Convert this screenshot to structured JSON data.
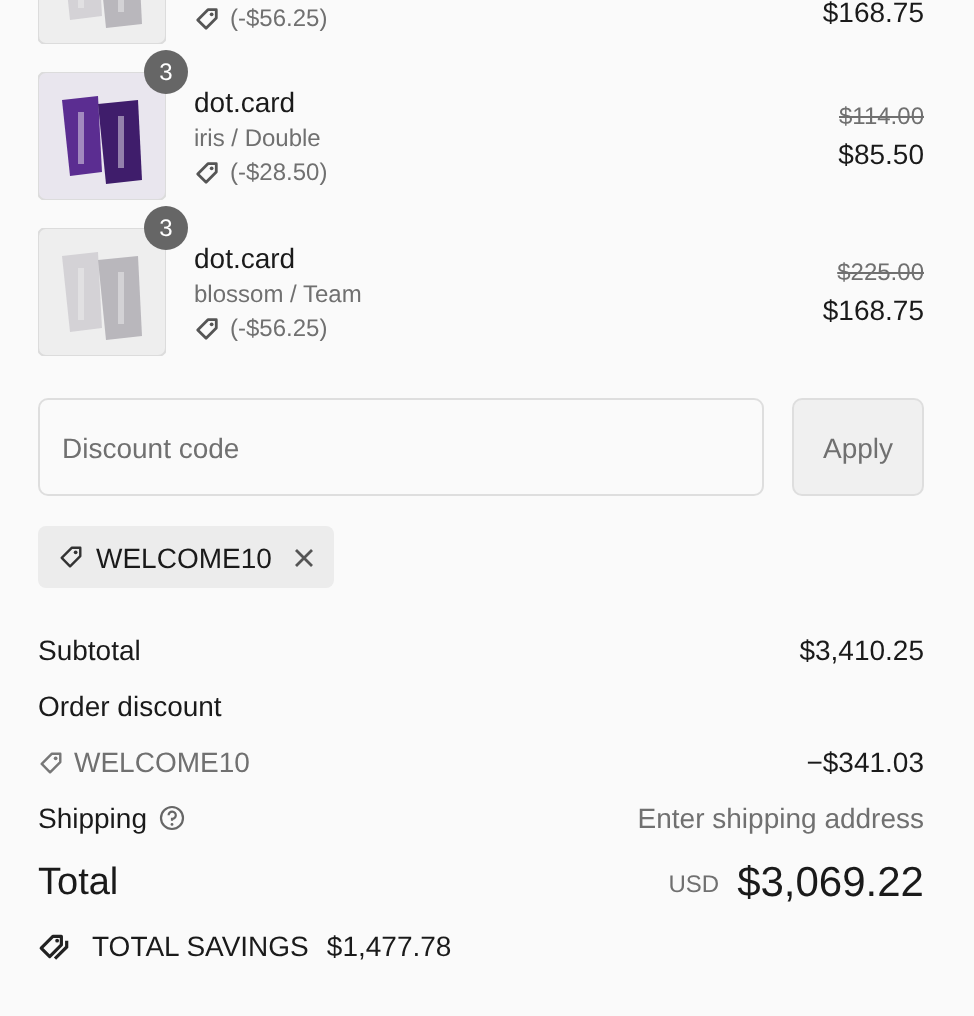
{
  "line_items": [
    {
      "kind": "cut",
      "discount": "(-$56.25)",
      "price": "$168.75"
    },
    {
      "kind": "full",
      "quantity": "3",
      "name": "dot.card",
      "variant": "iris / Double",
      "discount": "(-$28.50)",
      "original_price": "$114.00",
      "price": "$85.50"
    },
    {
      "kind": "full",
      "quantity": "3",
      "name": "dot.card",
      "variant": "blossom / Team",
      "discount": "(-$56.25)",
      "original_price": "$225.00",
      "price": "$168.75"
    }
  ],
  "discount_field": {
    "placeholder": "Discount code"
  },
  "apply_button": {
    "label": "Apply",
    "disabled": true
  },
  "applied_code": {
    "label": "WELCOME10"
  },
  "summary": {
    "subtotal_label": "Subtotal",
    "subtotal": "$3,410.25",
    "order_discount_label": "Order discount",
    "discount_code": "WELCOME10",
    "discount_amount": "−$341.03",
    "shipping_label": "Shipping",
    "shipping_value": "Enter shipping address",
    "total_label": "Total",
    "currency": "USD",
    "total": "$3,069.22",
    "savings_label": "TOTAL SAVINGS",
    "savings": "$1,477.78"
  }
}
